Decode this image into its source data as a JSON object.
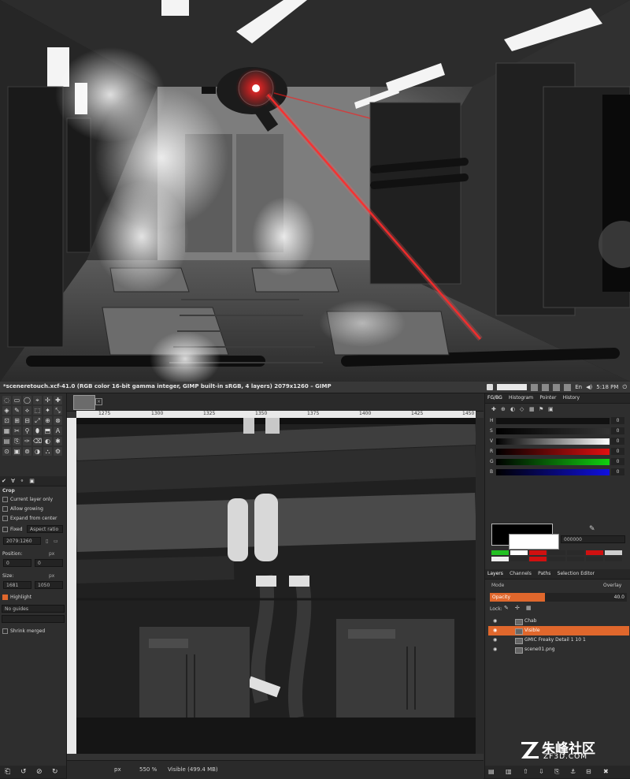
{
  "window": {
    "title": "*sceneretouch.xcf-41.0 (RGB color 16-bit gamma integer, GIMP built-in sRGB, 4 layers) 2079x1260 – GIMP",
    "tray_lang": "En",
    "tray_time": "5:18 PM"
  },
  "toolbox": {
    "tool_icons": [
      "◌",
      "▭",
      "◯",
      "⌖",
      "✢",
      "✚",
      "◈",
      "✎",
      "⟡",
      "⬚",
      "✦",
      "⤡",
      "⊡",
      "⊞",
      "⊟",
      "⤢",
      "⊕",
      "⊗",
      "▦",
      "✂",
      "⚲",
      "⬮",
      "⬒",
      "Ａ",
      "▤",
      "⎘",
      "✑",
      "⌫",
      "◐",
      "✱",
      "⊙",
      "▣",
      "⊚",
      "◑",
      "⛬",
      "⚙"
    ],
    "tabs": [
      "✔",
      "Ɐ",
      "⚬",
      "▣"
    ],
    "options_title": "Crop",
    "current_layer_only": "Current layer only",
    "allow_growing": "Allow growing",
    "expand_from_center": "Expand from center",
    "fixed": "Fixed",
    "aspect_ratio": "Aspect ratio",
    "ratio_value": "2079:1260",
    "position_label": "Position:",
    "position_unit": "px",
    "pos_x": "0",
    "pos_y": "0",
    "size_label": "Size:",
    "size_unit": "px",
    "size_w": "1681",
    "size_h": "1050",
    "highlight": "Highlight",
    "guides": "No guides",
    "shrink_merged": "Shrink merged",
    "bottom_icons": [
      "⎗",
      "↺",
      "⊘",
      "↻"
    ]
  },
  "canvas": {
    "ruler_ticks": [
      "1275",
      "1300",
      "1325",
      "1350",
      "1375",
      "1400",
      "1425",
      "1450"
    ],
    "status_unit": "px",
    "zoom": "550 %",
    "status_text": "Visible (499.4 MB)"
  },
  "dock": {
    "tabs_top": [
      "FG/BG",
      "Histogram",
      "Pointer",
      "History"
    ],
    "sliders": [
      {
        "label": "H",
        "value": "0",
        "gradient": "linear-gradient(90deg,#111,#111)"
      },
      {
        "label": "S",
        "value": "0",
        "gradient": "linear-gradient(90deg,#000,#333)"
      },
      {
        "label": "V",
        "value": "0",
        "gradient": "linear-gradient(90deg,#000,#fff)"
      },
      {
        "label": "R",
        "value": "0",
        "gradient": "linear-gradient(90deg,#000,#e01010)"
      },
      {
        "label": "G",
        "value": "0",
        "gradient": "linear-gradient(90deg,#000,#10d010)"
      },
      {
        "label": "B",
        "value": "0",
        "gradient": "linear-gradient(90deg,#000,#1010e0)"
      }
    ],
    "hex_value": "000000",
    "history_colors": [
      "#22c022",
      "#ffffff",
      "#d01010",
      "#2a2a2a",
      "#2a2a2a",
      "#d01010",
      "#cfcfcf",
      "#eeeeee",
      "#2a2a2a",
      "#d01010",
      "#2a2a2a",
      "#2a2a2a",
      "#2a2a2a",
      "#2a2a2a"
    ],
    "tabs_layers": [
      "Layers",
      "Channels",
      "Paths",
      "Selection Editor"
    ],
    "mode_label": "Mode",
    "mode_value": "Overlay",
    "opacity_label": "Opacity",
    "opacity_value": "40.0",
    "opacity_fraction": 0.4,
    "lock_label": "Lock:",
    "layers": [
      {
        "name": "Chab",
        "selected": false
      },
      {
        "name": "Visible",
        "selected": true
      },
      {
        "name": "GMIC Freaky Detail 1 10 1",
        "selected": false
      },
      {
        "name": "scene01.png",
        "selected": false
      }
    ],
    "bottom_icons": [
      "▤",
      "▥",
      "⇧",
      "⇩",
      "⎘",
      "⚓",
      "⊟",
      "✖"
    ]
  },
  "watermark": {
    "cn": "朱峰社区",
    "url": "ZF3D.COM"
  },
  "colors": {
    "accent": "#e0672c",
    "laser": "#ff1a1a"
  }
}
